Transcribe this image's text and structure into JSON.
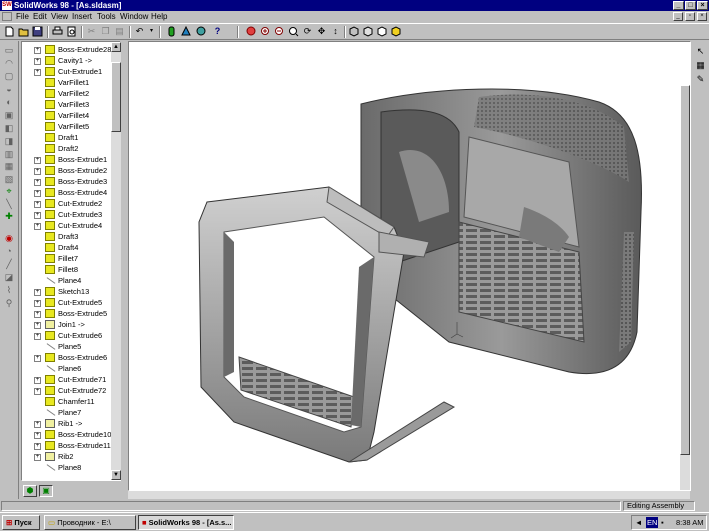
{
  "window": {
    "title": "SolidWorks 98 - [As.sldasm]",
    "app_icon": "SW"
  },
  "menu": [
    "File",
    "Edit",
    "View",
    "Insert",
    "Tools",
    "Window",
    "Help"
  ],
  "toolbar_icons": [
    "new-icon",
    "open-icon",
    "save-icon",
    "print-icon",
    "print-preview-icon",
    "cut-icon",
    "copy-icon",
    "paste-icon",
    "undo-icon",
    "rebuild-icon",
    "options-icon",
    "color-icon",
    "help-icon",
    "zoom-to-fit-icon",
    "zoom-in-icon",
    "zoom-out-icon",
    "rotate-icon",
    "pan-icon",
    "wireframe-icon",
    "hidden-lines-icon",
    "shaded-icon"
  ],
  "feature_tree": [
    {
      "label": "Boss-Extrude28",
      "expandable": true,
      "icon": "feature"
    },
    {
      "label": "Cavity1 ->",
      "expandable": true,
      "icon": "feature"
    },
    {
      "label": "Cut-Extrude1",
      "expandable": true,
      "icon": "feature"
    },
    {
      "label": "VarFillet1",
      "expandable": false,
      "icon": "feature"
    },
    {
      "label": "VarFillet2",
      "expandable": false,
      "icon": "feature"
    },
    {
      "label": "VarFillet3",
      "expandable": false,
      "icon": "feature"
    },
    {
      "label": "VarFillet4",
      "expandable": false,
      "icon": "feature"
    },
    {
      "label": "VarFillet5",
      "expandable": false,
      "icon": "feature"
    },
    {
      "label": "Draft1",
      "expandable": false,
      "icon": "feature"
    },
    {
      "label": "Draft2",
      "expandable": false,
      "icon": "feature"
    },
    {
      "label": "Boss-Extrude1",
      "expandable": true,
      "icon": "feature"
    },
    {
      "label": "Boss-Extrude2",
      "expandable": true,
      "icon": "feature"
    },
    {
      "label": "Boss-Extrude3",
      "expandable": true,
      "icon": "feature"
    },
    {
      "label": "Boss-Extrude4",
      "expandable": true,
      "icon": "feature"
    },
    {
      "label": "Cut-Extrude2",
      "expandable": true,
      "icon": "feature"
    },
    {
      "label": "Cut-Extrude3",
      "expandable": true,
      "icon": "feature"
    },
    {
      "label": "Cut-Extrude4",
      "expandable": true,
      "icon": "feature"
    },
    {
      "label": "Draft3",
      "expandable": false,
      "icon": "feature"
    },
    {
      "label": "Draft4",
      "expandable": false,
      "icon": "feature"
    },
    {
      "label": "Fillet7",
      "expandable": false,
      "icon": "feature"
    },
    {
      "label": "Fillet8",
      "expandable": false,
      "icon": "feature"
    },
    {
      "label": "Plane4",
      "expandable": false,
      "icon": "plane"
    },
    {
      "label": "Sketch13",
      "expandable": true,
      "icon": "feature"
    },
    {
      "label": "Cut-Extrude5",
      "expandable": true,
      "icon": "feature"
    },
    {
      "label": "Boss-Extrude5",
      "expandable": true,
      "icon": "feature"
    },
    {
      "label": "Join1 ->",
      "expandable": true,
      "icon": "part"
    },
    {
      "label": "Cut-Extrude6",
      "expandable": true,
      "icon": "feature"
    },
    {
      "label": "Plane5",
      "expandable": false,
      "icon": "plane"
    },
    {
      "label": "Boss-Extrude6",
      "expandable": true,
      "icon": "feature"
    },
    {
      "label": "Plane6",
      "expandable": false,
      "icon": "plane"
    },
    {
      "label": "Cut-Extrude71",
      "expandable": true,
      "icon": "feature"
    },
    {
      "label": "Cut-Extrude72",
      "expandable": true,
      "icon": "feature"
    },
    {
      "label": "Chamfer11",
      "expandable": false,
      "icon": "feature"
    },
    {
      "label": "Plane7",
      "expandable": false,
      "icon": "plane"
    },
    {
      "label": "Rib1 ->",
      "expandable": true,
      "icon": "part"
    },
    {
      "label": "Boss-Extrude10",
      "expandable": true,
      "icon": "feature"
    },
    {
      "label": "Boss-Extrude11",
      "expandable": true,
      "icon": "feature"
    },
    {
      "label": "Rib2",
      "expandable": true,
      "icon": "part"
    },
    {
      "label": "Plane8",
      "expandable": false,
      "icon": "plane"
    }
  ],
  "statusbar": {
    "message": "",
    "mode": "Editing Assembly"
  },
  "taskbar": {
    "start": "Пуск",
    "buttons": [
      "Проводник - E:\\",
      "SolidWorks 98 - [As.s..."
    ],
    "tray_lang": "EN",
    "time": "8:38 AM"
  },
  "colors": {
    "titlebar": "#000080",
    "feature_icon": "#e8e820",
    "model_gray": "#8a8a8a"
  }
}
